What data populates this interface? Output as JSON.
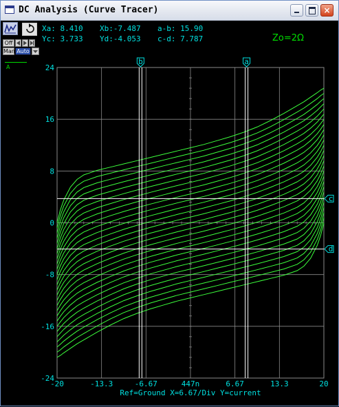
{
  "window": {
    "title": "DC Analysis (Curve Tracer)",
    "close_glyph": "×"
  },
  "toolbar": {
    "curve_icon": "curve-tracer-icon",
    "reset_icon": "rotate-icon",
    "controls": [
      "Off",
      "Man",
      "Auto"
    ]
  },
  "readouts": {
    "xa": "Xa: 8.410",
    "xb": "Xb:-7.487",
    "ab": "a-b: 15.90",
    "yc": "Yc: 3.733",
    "yd": "Yd:-4.053",
    "cd": "c-d: 7.787"
  },
  "annotation": {
    "zo": "Zo=2Ω"
  },
  "trace": {
    "label": "A"
  },
  "cursors": {
    "a": "a",
    "b": "b",
    "c": "c",
    "d": "d"
  },
  "chart_data": {
    "type": "line",
    "xlabel": "",
    "ylabel": "",
    "xlim": [
      -20,
      20
    ],
    "ylim": [
      -24,
      24
    ],
    "x_ticks": [
      "-20",
      "-13.3",
      "-6.67",
      "447n",
      "6.67",
      "13.3",
      "20"
    ],
    "y_ticks": [
      "24",
      "16",
      "8",
      "0",
      "-8",
      "-16",
      "-24"
    ],
    "footer": "Ref=Ground  X=6.67/Div Y=current",
    "grid": true,
    "colors": {
      "trace": "#3cff3c",
      "grid": "#8a8a8a",
      "cursor": "#ffffff",
      "text": "#00e0e0"
    },
    "cursor_values": {
      "xa": 8.41,
      "xb": -7.487,
      "yc": 3.733,
      "yd": -4.053
    },
    "curve_family": {
      "count": 27,
      "x_points": [
        -20,
        -19.5,
        -19,
        -18,
        -17,
        -16,
        -14,
        -12,
        -10,
        -8,
        -6,
        -4,
        -2,
        0,
        2,
        4,
        6,
        8,
        10,
        12,
        14,
        16,
        17,
        18,
        19,
        19.5,
        20
      ],
      "upper_envelope_y": [
        0,
        2,
        3.5,
        5.5,
        6.7,
        7.4,
        8.1,
        8.6,
        9.1,
        9.6,
        10.1,
        10.6,
        11.1,
        11.6,
        12.1,
        12.7,
        13.3,
        14,
        14.8,
        15.8,
        16.9,
        18.1,
        18.7,
        19.4,
        20.1,
        20.5,
        20.8
      ],
      "lower_envelope_y": [
        -20.8,
        -20.5,
        -20.1,
        -19.4,
        -18.7,
        -18.1,
        -16.9,
        -15.8,
        -14.8,
        -14,
        -13.3,
        -12.7,
        -12.1,
        -11.6,
        -11.1,
        -10.6,
        -10.1,
        -9.6,
        -9.1,
        -8.6,
        -8.1,
        -7.4,
        -6.7,
        -5.5,
        -3.5,
        -2,
        0
      ]
    }
  }
}
